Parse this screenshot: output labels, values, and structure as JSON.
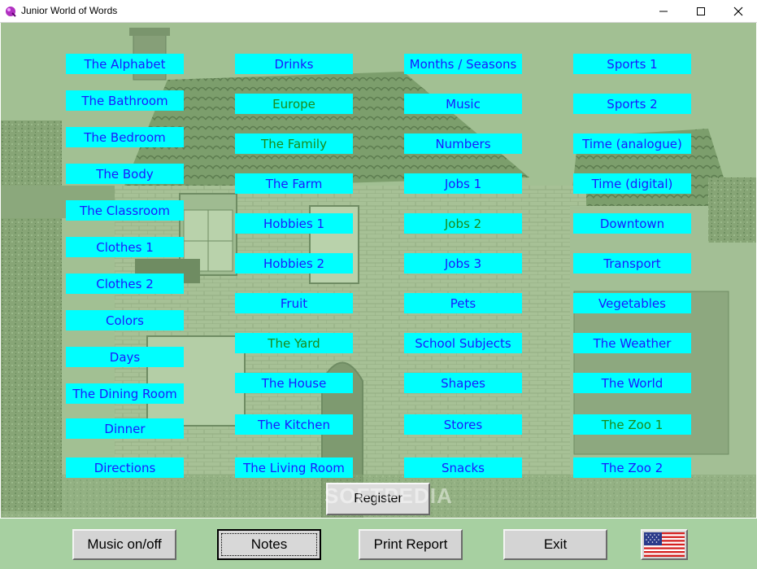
{
  "window": {
    "title": "Junior World of Words"
  },
  "topics": {
    "col1": [
      "The Alphabet",
      "The Bathroom",
      "The Bedroom",
      "The Body",
      "The Classroom",
      "Clothes 1",
      "Clothes 2",
      "Colors",
      "Days",
      "The Dining Room",
      "Dinner",
      "Directions"
    ],
    "col2": [
      "Drinks",
      "Europe",
      "The Family",
      "The Farm",
      "Hobbies 1",
      "Hobbies 2",
      "Fruit",
      "The Yard",
      "The House",
      "The Kitchen",
      "The Living Room"
    ],
    "col3": [
      "Months / Seasons",
      "Music",
      "Numbers",
      "Jobs 1",
      "Jobs 2",
      "Jobs 3",
      "Pets",
      "School Subjects",
      "Shapes",
      "Stores",
      "Snacks"
    ],
    "col4": [
      "Sports 1",
      "Sports 2",
      "Time (analogue)",
      "Time (digital)",
      "Downtown",
      "Transport",
      "Vegetables",
      "The Weather",
      "The World",
      "The Zoo 1",
      "The Zoo 2"
    ]
  },
  "register_label": "Register",
  "watermark": "SOFTPEDIA",
  "bottom": {
    "music": "Music on/off",
    "notes": "Notes",
    "print": "Print Report",
    "exit": "Exit",
    "flag_icon": "us-flag-icon"
  },
  "colors": {
    "topic_bg": "#00ffff",
    "topic_text": "#1a1aff",
    "topic_done_text": "#1a8a1a",
    "scene_bg": "#9fbd90",
    "bottom_bg": "#a7d0a1"
  }
}
